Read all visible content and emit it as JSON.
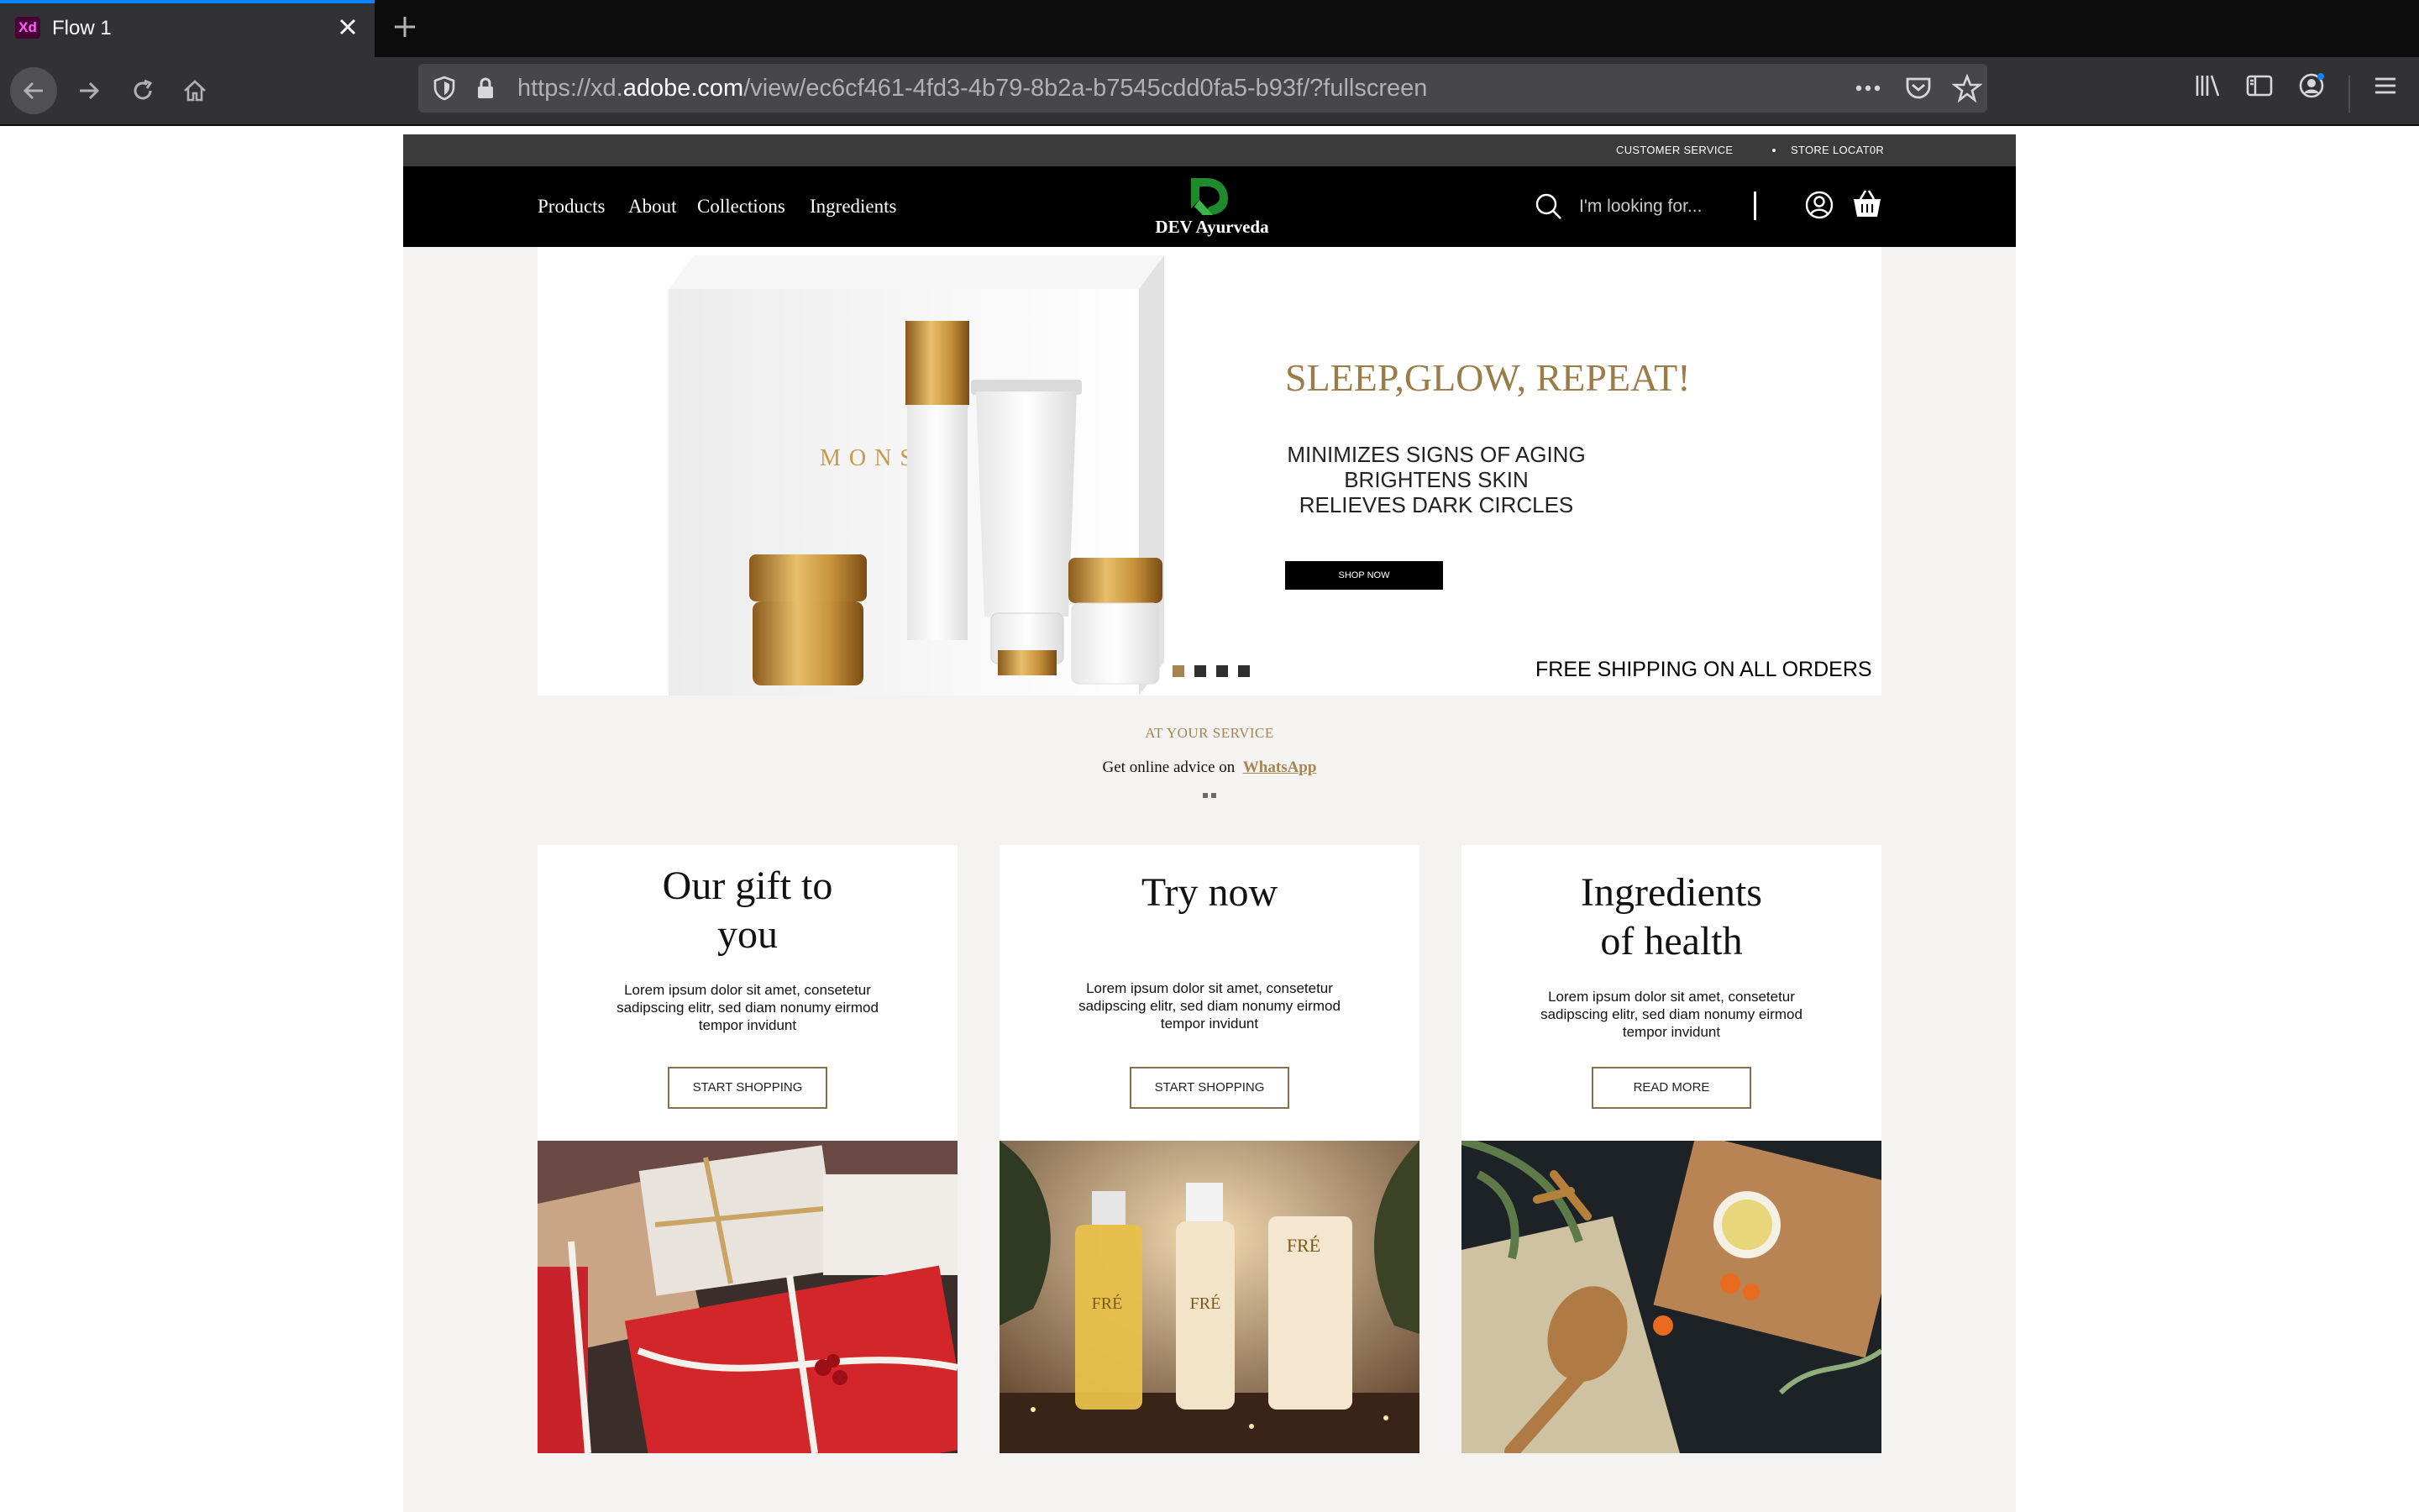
{
  "browser": {
    "tab_title": "Flow 1",
    "app_icon_label": "Xd",
    "url_prefix": "https://xd.",
    "url_domain": "adobe.com",
    "url_path": "/view/ec6cf461-4fd3-4b79-8b2a-b7545cdd0fa5-b93f/?fullscreen"
  },
  "site": {
    "topbar": {
      "customer_service": "CUSTOMER SERVICE",
      "store_locator": "STORE LOCAT0R"
    },
    "nav": [
      "Products",
      "About",
      "Collections",
      "Ingredients"
    ],
    "logo_text": "DEV Ayurveda",
    "search_placeholder": "I'm looking for...",
    "hero": {
      "headline": "SLEEP,GLOW, REPEAT!",
      "features": [
        "MINIMIZES SIGNS OF AGING",
        "BRIGHTENS SKIN",
        "RELIEVES DARK CIRCLES"
      ],
      "cta": "SHOP NOW",
      "free_shipping": "FREE SHIPPING ON ALL ORDERS",
      "product_brand": "MONSA"
    },
    "service": {
      "kicker": "AT YOUR SERVICE",
      "line": "Get online advice on",
      "link": "WhatsApp"
    },
    "cards": [
      {
        "title_line1": "Our gift to",
        "title_line2": "you",
        "text": "Lorem ipsum dolor sit amet, consetetur sadipscing elitr, sed diam nonumy eirmod tempor invidunt",
        "button": "START SHOPPING"
      },
      {
        "title_line1": "Try now",
        "title_line2": "",
        "text": "Lorem ipsum dolor sit amet, consetetur sadipscing elitr, sed diam nonumy eirmod tempor invidunt",
        "button": "START SHOPPING"
      },
      {
        "title_line1": "Ingredients",
        "title_line2": "of health",
        "text": "Lorem ipsum dolor sit amet, consetetur sadipscing elitr, sed diam nonumy eirmod tempor invidunt",
        "button": "READ MORE"
      }
    ],
    "card_image_brand": "FRÉ"
  },
  "colors": {
    "accent_gold": "#a6844f",
    "header_black": "#000000",
    "page_bg": "#f4f3f1"
  }
}
